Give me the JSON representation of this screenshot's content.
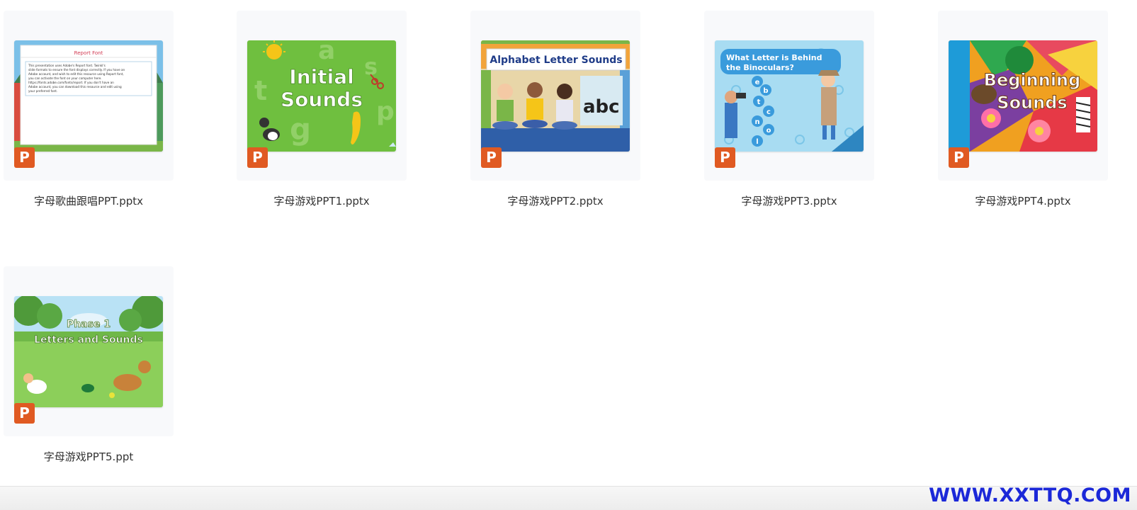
{
  "files": [
    {
      "name": "字母歌曲跟唱PPT.pptx",
      "badge": "P",
      "slide_title": "Report Font",
      "slide_lines": [
        "This presentation uses Adobe's Report font. Twinkl's",
        "slide formats to ensure the font displays correctly. If you have an",
        "Adobe account, and wish to edit this resource using Report font,",
        "you can activate the font on your computer here.",
        "https://fonts.adobe.com/fonts/report. If you don't have an",
        "Adobe account, you can download this resource and edit using",
        "your preferred font."
      ]
    },
    {
      "name": "字母游戏PPT1.pptx",
      "badge": "P",
      "slide_title_lines": [
        "Initial",
        "Sounds"
      ],
      "slide_letters": [
        "a",
        "t",
        "s",
        "g",
        "p"
      ]
    },
    {
      "name": "字母游戏PPT2.pptx",
      "badge": "P",
      "slide_title": "Alphabet Letter Sounds",
      "slide_letters": "abc"
    },
    {
      "name": "字母游戏PPT3.pptx",
      "badge": "P",
      "slide_title_lines": [
        "What Letter is Behind",
        "the Binoculars?"
      ],
      "slide_letters": [
        "e",
        "b",
        "t",
        "c",
        "n",
        "o",
        "l"
      ]
    },
    {
      "name": "字母游戏PPT4.pptx",
      "badge": "P",
      "slide_title_lines": [
        "Beginning",
        "Sounds"
      ]
    },
    {
      "name": "字母游戏PPT5.ppt",
      "badge": "P",
      "slide_title_lines": [
        "Phase 1",
        "Letters and Sounds"
      ]
    }
  ],
  "watermark": "WWW.XXTTQ.COM",
  "colors": {
    "ppt_badge": "#e05a22",
    "watermark": "#1b28d8"
  }
}
